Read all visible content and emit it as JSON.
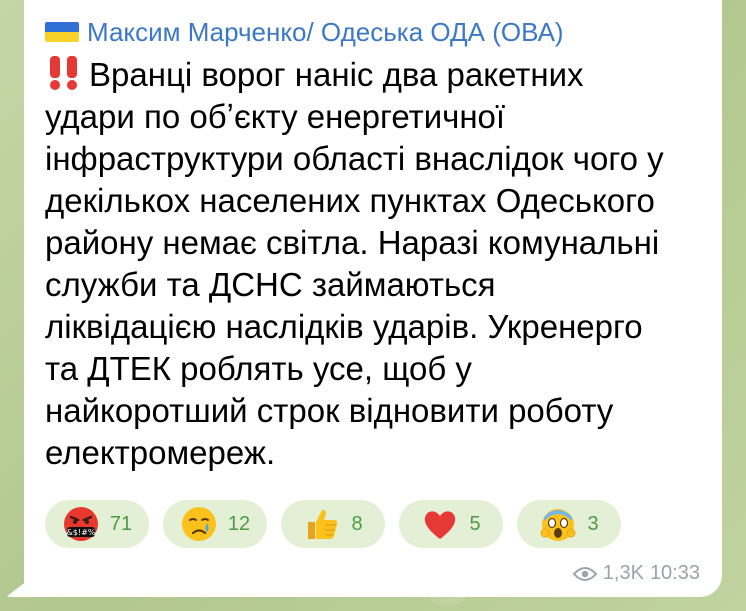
{
  "message": {
    "sender": "Максим Марченко/ Одеська ОДА (ОВА)",
    "lines": [
      "Вранці ворог наніс два ракетних",
      "удари по обʼєкту енергетичної",
      "інфраструктури області внаслідок чого у",
      "декількох населених пунктах Одеського",
      "району немає світла. Наразі комунальні",
      "служби та ДСНС займаються",
      "ліквідацією наслідків ударів. Укренерго",
      "та ДТЕК роблять усе, щоб у",
      "найкоротший строк відновити роботу",
      "електромереж."
    ],
    "views": "1,3K",
    "time": "10:33"
  },
  "reactions": [
    {
      "icon": "angry-cursing-face-icon",
      "count": "71"
    },
    {
      "icon": "crying-face-icon",
      "count": "12"
    },
    {
      "icon": "thumbs-up-icon",
      "count": "8"
    },
    {
      "icon": "red-heart-icon",
      "count": "5"
    },
    {
      "icon": "screaming-face-icon",
      "count": "3"
    }
  ],
  "colors": {
    "sender": "#3c78c8",
    "reaction_bg": "#e3f0d6",
    "reaction_count": "#4e9a46",
    "meta": "#9aa3a9"
  }
}
